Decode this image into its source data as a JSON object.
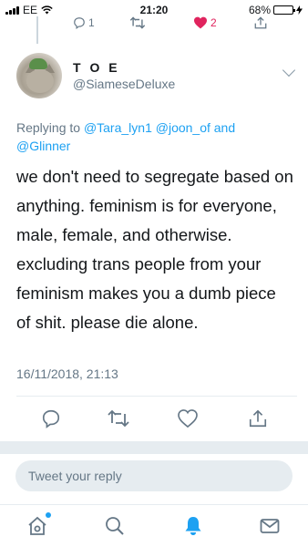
{
  "status_bar": {
    "carrier": "EE",
    "time": "21:20",
    "battery_percent": "68%",
    "battery_level": 0.68,
    "wifi_icon": "wifi-icon",
    "charging_icon": "charging-bolt-icon"
  },
  "previous_tweet_actions": {
    "reply_count": "1",
    "like_count": "2",
    "liked": true
  },
  "tweet": {
    "display_name": "T O E",
    "handle": "@SiameseDeluxe",
    "reply_prefix": "Replying to",
    "reply_mentions": "@Tara_lyn1 @joon_of and @Glinner",
    "text": "we don't need to segregate based on anything. feminism is for everyone, male, female, and otherwise. excluding trans people from your feminism makes you a dumb piece of shit. please die alone.",
    "timestamp": "16/11/2018, 21:13"
  },
  "reply_composer": {
    "placeholder": "Tweet your reply"
  },
  "tab_bar": {
    "items": [
      "home-icon",
      "search-icon",
      "notifications-icon",
      "messages-icon"
    ],
    "active": "notifications-icon"
  },
  "colors": {
    "accent": "#1da1f2",
    "like": "#e0245e",
    "secondary_text": "#657786",
    "divider": "#e6ecf0"
  }
}
